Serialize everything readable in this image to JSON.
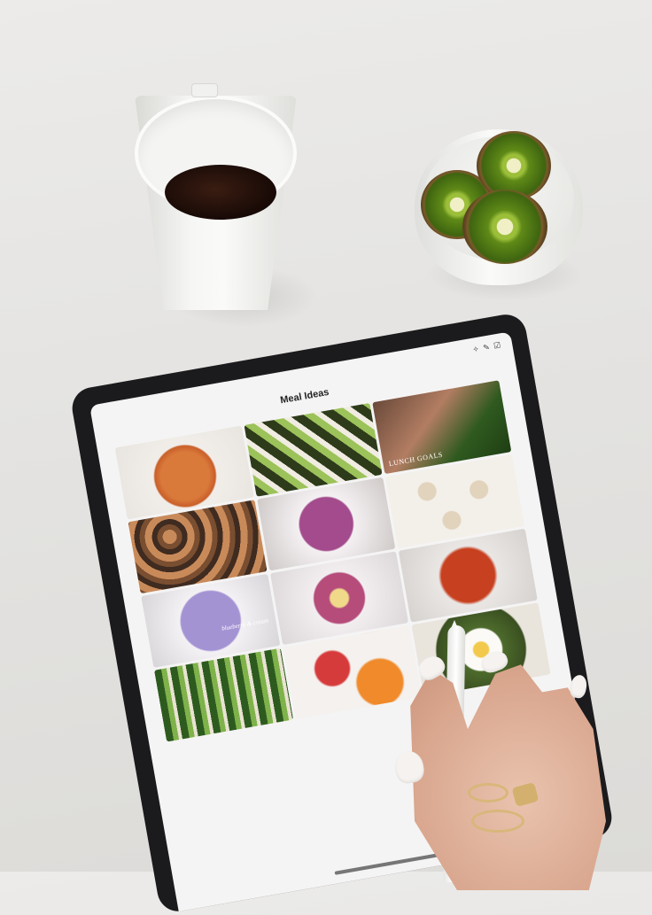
{
  "tablet": {
    "status_icons": "✧ ✎ ☑",
    "board_title": "Meal Ideas"
  },
  "collage": {
    "tiles": [
      {
        "kind": "spaghetti",
        "caption": ""
      },
      {
        "kind": "sushi",
        "caption": ""
      },
      {
        "kind": "salmon-salad",
        "caption": "LUNCH GOALS"
      },
      {
        "kind": "muffins",
        "caption": ""
      },
      {
        "kind": "smoothie-bowl",
        "caption": ""
      },
      {
        "kind": "protein-balls",
        "caption": ""
      },
      {
        "kind": "lavender-dip",
        "caption": "blueberry & cream"
      },
      {
        "kind": "banana-bowl",
        "caption": ""
      },
      {
        "kind": "pasta",
        "caption": ""
      },
      {
        "kind": "veg-market",
        "caption": ""
      },
      {
        "kind": "fruit-plate",
        "caption": ""
      },
      {
        "kind": "egg-toast",
        "caption": ""
      }
    ]
  },
  "colors": {
    "table": "#e6e5e3",
    "tablet_bezel": "#1b1b1d",
    "kiwi_green": "#4a7413",
    "coffee": "#1e0b06"
  }
}
